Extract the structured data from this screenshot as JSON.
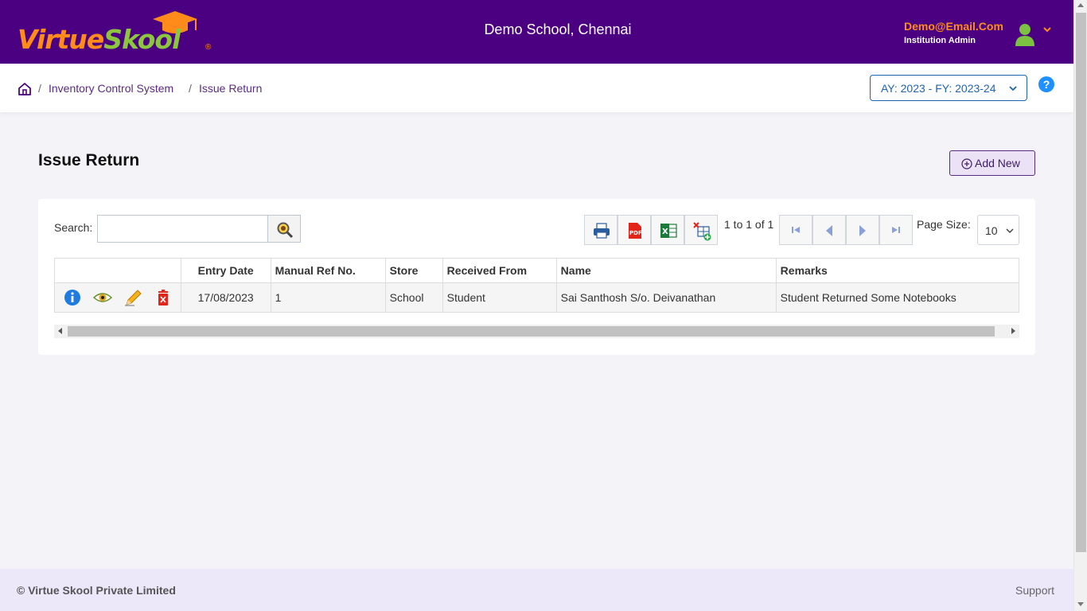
{
  "header": {
    "logo_part1": "Virtue",
    "logo_part2": "Skool",
    "logo_reg": "®",
    "school_name": "Demo School, Chennai",
    "user_email": "Demo@Email.Com",
    "user_role": "Institution Admin"
  },
  "breadcrumb": {
    "items": [
      "Inventory Control System",
      "Issue Return"
    ],
    "separator": "/"
  },
  "academic_year_select": "AY: 2023 - FY: 2023-24",
  "help": "?",
  "page": {
    "title": "Issue Return",
    "add_new_label": "Add New"
  },
  "toolbar": {
    "search_label": "Search:",
    "search_value": "",
    "search_placeholder": "",
    "pager_text": "1 to 1 of 1",
    "page_size_label": "Page Size:",
    "page_size_value": "10"
  },
  "table": {
    "columns": [
      "",
      "Entry Date",
      "Manual Ref No.",
      "Store",
      "Received From",
      "Name",
      "Remarks"
    ],
    "rows": [
      {
        "entry_date": "17/08/2023",
        "manual_ref_no": "1",
        "store": "School",
        "received_from": "Student",
        "name": "Sai Santhosh S/o. Deivanathan",
        "remarks": "Student Returned Some Notebooks"
      }
    ],
    "row_actions": [
      "info-icon",
      "view-icon",
      "edit-icon",
      "delete-icon"
    ]
  },
  "footer": {
    "copyright": "© Virtue Skool Private Limited",
    "support": "Support"
  },
  "colors": {
    "header_bg": "#4b0082",
    "accent_orange": "#ff8c1a",
    "accent_green": "#8cc63f",
    "link_purple": "#5b2a86",
    "select_blue": "#1e64b4",
    "footer_bg": "#ece8fa"
  }
}
